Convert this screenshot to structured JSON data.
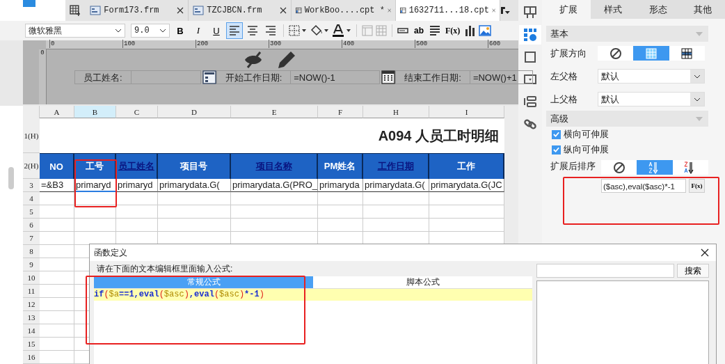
{
  "tabs": [
    {
      "label": "Form173.frm",
      "kind": "form",
      "selected": false
    },
    {
      "label": "TZCJBCN.frm",
      "kind": "form",
      "selected": false
    },
    {
      "label": "WorkBoo....cpt *",
      "kind": "cpt",
      "selected": false
    },
    {
      "label": "1632711...18.cpt",
      "kind": "cpt",
      "selected": true
    }
  ],
  "toolbar": {
    "font": "微软雅黑",
    "size": "9.0",
    "styles": [
      "B",
      "I",
      "U"
    ],
    "alignments": [
      {
        "kind": "left",
        "selected": true
      },
      {
        "kind": "center",
        "selected": false
      },
      {
        "kind": "right",
        "selected": false
      }
    ],
    "text_tool": "ab",
    "formula_tool": "F(x)"
  },
  "ruler": {
    "ticks": [
      "0",
      "100",
      "200",
      "300",
      "400",
      "500",
      "600"
    ],
    "vertical_tick": "0"
  },
  "parameters": [
    {
      "label": "员工姓名:",
      "kind": "text"
    },
    {
      "label": "开始工作日期:",
      "kind": "form",
      "value": "=NOW()-1"
    },
    {
      "label": "结束工作日期:",
      "kind": "date",
      "value": "=NOW()+1"
    }
  ],
  "sheet": {
    "columns": [
      {
        "label": "A",
        "selected": false
      },
      {
        "label": "B",
        "selected": true
      },
      {
        "label": "C",
        "selected": false
      },
      {
        "label": "D",
        "selected": false
      },
      {
        "label": "E",
        "selected": false
      },
      {
        "label": "F",
        "selected": false
      },
      {
        "label": "H",
        "selected": false
      },
      {
        "label": "I",
        "selected": false
      }
    ],
    "row_labels": [
      "1(H)",
      "2(H)",
      "3",
      "4",
      "5",
      "6",
      "7",
      "8",
      "9",
      "10",
      "11",
      "12",
      "13",
      "14",
      "15",
      "16"
    ],
    "title": "A094 人员工时明细",
    "headers": [
      {
        "text": "NO",
        "link": false
      },
      {
        "text": "工号",
        "link": false
      },
      {
        "text": "员工姓名",
        "link": true
      },
      {
        "text": "项目号",
        "link": false
      },
      {
        "text": "项目名称",
        "link": true
      },
      {
        "text": "PM姓名",
        "link": false
      },
      {
        "text": "工作日期",
        "link": true
      },
      {
        "text": "工作",
        "link": false
      }
    ],
    "data_row": [
      {
        "text": "=&B3",
        "selected": false
      },
      {
        "text": "primaryd",
        "selected": true
      },
      {
        "text": "primaryd",
        "selected": false
      },
      {
        "text": "primarydata.G(",
        "selected": false
      },
      {
        "text": "primarydata.G(PRO_",
        "selected": false
      },
      {
        "text": "primaryda",
        "selected": false
      },
      {
        "text": "primarydata.G(",
        "selected": false
      },
      {
        "text": "primarydata.G(JC",
        "selected": false
      }
    ]
  },
  "side_icons": [
    {
      "kind": "layout",
      "selected": false
    },
    {
      "kind": "cell",
      "selected": true
    },
    {
      "kind": "frame",
      "selected": false
    },
    {
      "kind": "widget",
      "selected": false
    },
    {
      "kind": "stack",
      "selected": false
    },
    {
      "kind": "link",
      "selected": false
    }
  ],
  "panel": {
    "tabs": [
      {
        "label": "扩展",
        "selected": true
      },
      {
        "label": "样式",
        "selected": false
      },
      {
        "label": "形态",
        "selected": false
      },
      {
        "label": "其他",
        "selected": false
      }
    ],
    "basic": "基本",
    "direction": {
      "label": "扩展方向",
      "options": [
        {
          "kind": "none",
          "selected": false
        },
        {
          "kind": "vertical",
          "selected": true
        },
        {
          "kind": "horizontal",
          "selected": false
        }
      ]
    },
    "parents": [
      {
        "label": "左父格",
        "value": "默认"
      },
      {
        "label": "上父格",
        "value": "默认"
      }
    ],
    "advanced": "高级",
    "checkboxes": [
      {
        "label": "横向可伸展",
        "checked": true
      },
      {
        "label": "纵向可伸展",
        "checked": true
      }
    ],
    "sort": {
      "label": "扩展后排序",
      "options": [
        {
          "kind": "none",
          "selected": false
        },
        {
          "kind": "asc",
          "selected": true
        },
        {
          "kind": "desc",
          "selected": false
        }
      ],
      "formula": "($asc),eval($asc)*-1",
      "button": "F(x)"
    }
  },
  "dialog": {
    "title": "函数定义",
    "prompt": "请在下面的文本编辑框里面输入公式:",
    "tabs": [
      {
        "label": "常规公式",
        "selected": true
      },
      {
        "label": "脚本公式",
        "selected": false
      }
    ],
    "formula": [
      {
        "text": "if",
        "kind": "keyword"
      },
      {
        "text": "(",
        "kind": "paren"
      },
      {
        "text": "$a",
        "kind": "variable"
      },
      {
        "text": "==1,",
        "kind": "plain"
      },
      {
        "text": "eval",
        "kind": "keyword"
      },
      {
        "text": "(",
        "kind": "paren"
      },
      {
        "text": "$asc",
        "kind": "variable"
      },
      {
        "text": ")",
        "kind": "paren"
      },
      {
        "text": ",",
        "kind": "plain"
      },
      {
        "text": "eval",
        "kind": "keyword"
      },
      {
        "text": "(",
        "kind": "paren"
      },
      {
        "text": "$asc",
        "kind": "variable"
      },
      {
        "text": ")",
        "kind": "paren"
      },
      {
        "text": "*-1",
        "kind": "plain"
      },
      {
        "text": ")",
        "kind": "paren"
      }
    ],
    "search_button": "搜索"
  }
}
